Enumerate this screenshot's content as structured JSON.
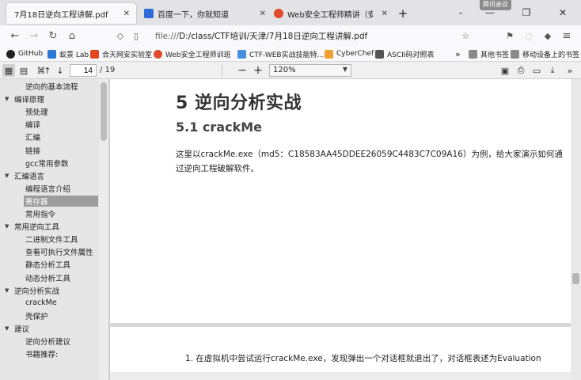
{
  "tabs": [
    {
      "title": "7月18日逆向工程讲解.pdf",
      "active": true
    },
    {
      "title": "百度一下，你就知道",
      "active": false
    },
    {
      "title": "Web安全工程师精讲（安全",
      "active": false
    }
  ],
  "new_tab_label": "+",
  "recording_badge": "腾讯会议",
  "url": {
    "prefix": "file:///",
    "path": "D:/class/CTF培训/天津/7月18日逆向工程讲解.pdf"
  },
  "bookmarks": [
    {
      "label": "GitHub",
      "color": "#222222"
    },
    {
      "label": "蚁景 Lab",
      "color": "#2b79d6"
    },
    {
      "label": "合天网安实验室",
      "color": "#e2451f"
    },
    {
      "label": "Web安全工程师训班",
      "color": "#e04b2e"
    },
    {
      "label": "CTF-WEB实战技能特...",
      "color": "#4a8ee0"
    },
    {
      "label": "CyberChef",
      "color": "#f0a030"
    },
    {
      "label": "ASCII码对照表",
      "color": "#555555"
    }
  ],
  "bookmarks_overflow": "»",
  "other_bookmarks": "其他书签",
  "mobile_bookmarks": "移动设备上的书签",
  "pdf_toolbar": {
    "current_page": "14",
    "page_count": "/ 19",
    "zoom": "120%",
    "zoom_out": "−",
    "zoom_in": "+"
  },
  "outline": [
    {
      "label": "逆向的基本流程",
      "level": 1,
      "selected": false
    },
    {
      "label": "编译原理",
      "level": 0,
      "selected": false
    },
    {
      "label": "预处理",
      "level": 1,
      "selected": false
    },
    {
      "label": "编译",
      "level": 1,
      "selected": false
    },
    {
      "label": "汇编",
      "level": 1,
      "selected": false
    },
    {
      "label": "链接",
      "level": 1,
      "selected": false
    },
    {
      "label": "gcc常用参数",
      "level": 1,
      "selected": false
    },
    {
      "label": "汇编语言",
      "level": 0,
      "selected": false
    },
    {
      "label": "编程语言介绍",
      "level": 1,
      "selected": false
    },
    {
      "label": "寄存器",
      "level": 1,
      "selected": true
    },
    {
      "label": "常用指令",
      "level": 1,
      "selected": false
    },
    {
      "label": "常用逆向工具",
      "level": 0,
      "selected": false
    },
    {
      "label": "二进制文件工具",
      "level": 1,
      "selected": false
    },
    {
      "label": "查看可执行文件属性",
      "level": 1,
      "selected": false
    },
    {
      "label": "静态分析工具",
      "level": 1,
      "selected": false
    },
    {
      "label": "动态分析工具",
      "level": 1,
      "selected": false
    },
    {
      "label": "逆向分析实战",
      "level": 0,
      "selected": false
    },
    {
      "label": "crackMe",
      "level": 1,
      "selected": false
    },
    {
      "label": "壳保护",
      "level": 1,
      "selected": false
    },
    {
      "label": "建议",
      "level": 0,
      "selected": false
    },
    {
      "label": "逆向分析建议",
      "level": 1,
      "selected": false
    },
    {
      "label": "书籍推荐:",
      "level": 1,
      "selected": false
    }
  ],
  "document": {
    "heading1": "5 逆向分析实战",
    "heading2": "5.1 crackMe",
    "paragraph": "这里以crackMe.exe（md5：C18583AA45DDEE26059C4483C7C09A16）为例，给大家演示如何通过逆向工程破解软件。",
    "next_page_text": "1. 在虚拟机中尝试运行crackMe.exe，发现弹出一个对话框就退出了，对话框表述为Evaluation"
  }
}
